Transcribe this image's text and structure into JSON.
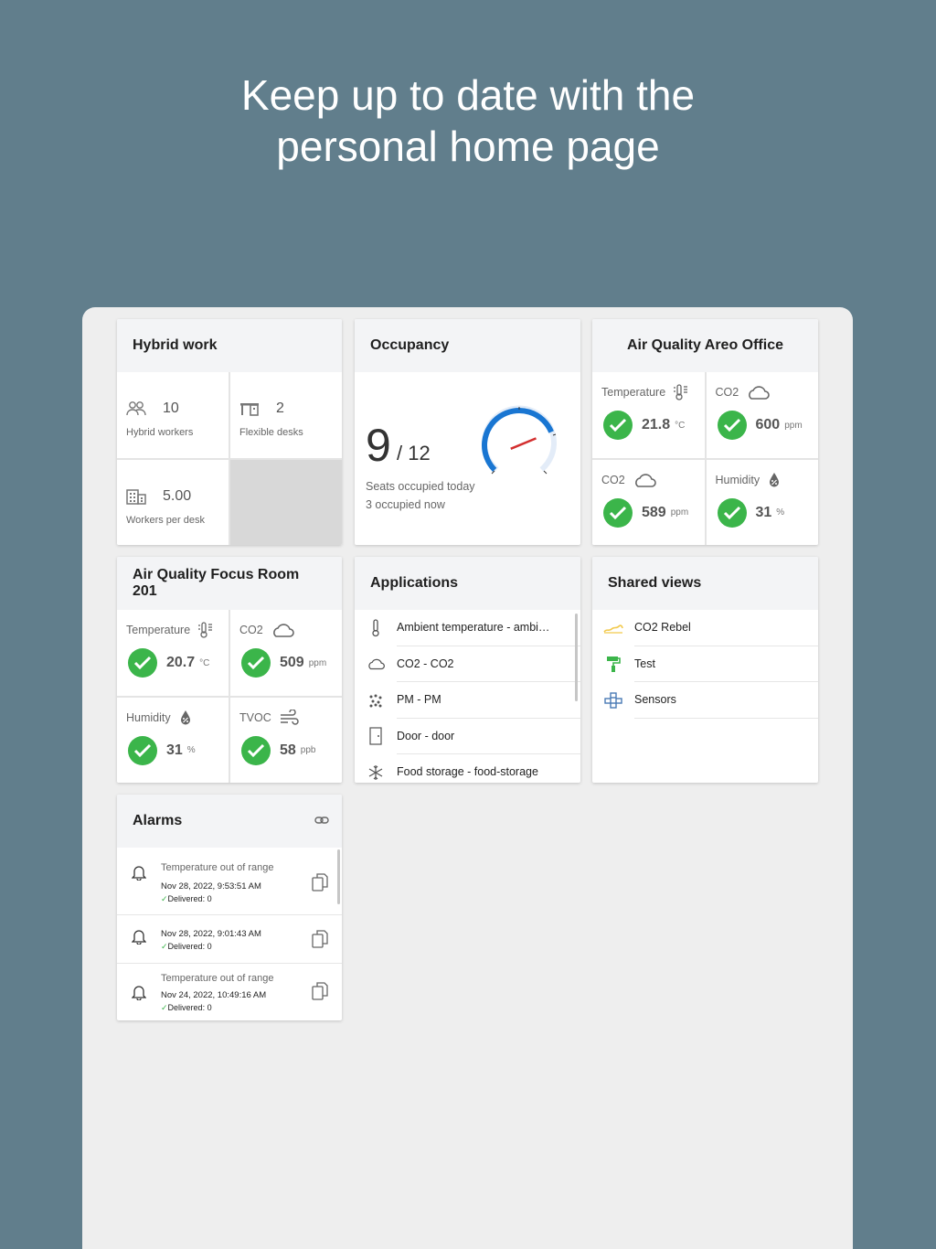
{
  "headline": {
    "line1": "Keep up to date with the",
    "line2": "personal home page"
  },
  "hybrid": {
    "title": "Hybrid work",
    "workers_value": "10",
    "workers_label": "Hybrid workers",
    "desks_value": "2",
    "desks_label": "Flexible desks",
    "ratio_value": "5.00",
    "ratio_label": "Workers per desk"
  },
  "occupancy": {
    "title": "Occupancy",
    "occupied": "9",
    "total": "/ 12",
    "line1": "Seats occupied today",
    "line2": "3 occupied now",
    "fraction": 0.75
  },
  "aq_office": {
    "title": "Air Quality Areo Office",
    "cells": [
      {
        "label": "Temperature",
        "value": "21.8",
        "unit": "°C"
      },
      {
        "label": "CO2",
        "value": "600",
        "unit": "ppm"
      },
      {
        "label": "CO2",
        "value": "589",
        "unit": "ppm"
      },
      {
        "label": "Humidity",
        "value": "31",
        "unit": "%"
      }
    ]
  },
  "aq_focus": {
    "title": "Air Quality Focus Room 201",
    "cells": [
      {
        "label": "Temperature",
        "value": "20.7",
        "unit": "°C"
      },
      {
        "label": "CO2",
        "value": "509",
        "unit": "ppm"
      },
      {
        "label": "Humidity",
        "value": "31",
        "unit": "%"
      },
      {
        "label": "TVOC",
        "value": "58",
        "unit": "ppb"
      }
    ]
  },
  "applications": {
    "title": "Applications",
    "items": [
      {
        "label": "Ambient temperature - ambi…",
        "icon": "thermometer-icon"
      },
      {
        "label": "CO2 - CO2",
        "icon": "cloud-icon"
      },
      {
        "label": "PM - PM",
        "icon": "particles-icon"
      },
      {
        "label": "Door - door",
        "icon": "door-icon"
      },
      {
        "label": "Food storage - food-storage",
        "icon": "snowflake-icon"
      }
    ]
  },
  "shared": {
    "title": "Shared views",
    "items": [
      {
        "label": "CO2 Rebel",
        "icon": "wave-icon",
        "color": "#f2c94c"
      },
      {
        "label": "Test",
        "icon": "paint-roller-icon",
        "color": "#3bb54a"
      },
      {
        "label": "Sensors",
        "icon": "network-icon",
        "color": "#4a7ab5"
      }
    ]
  },
  "alarms": {
    "title": "Alarms",
    "items": [
      {
        "title": "Temperature out of range",
        "date": "Nov 28, 2022, 9:53:51 AM",
        "delivered": "Delivered: 0"
      },
      {
        "title": "",
        "date": "Nov 28, 2022, 9:01:43 AM",
        "delivered": "Delivered: 0"
      },
      {
        "title": "Temperature out of range",
        "date": "Nov 24, 2022, 10:49:16 AM",
        "delivered": "Delivered: 0"
      }
    ]
  },
  "colors": {
    "background": "#617e8c",
    "check": "#3bb54a",
    "gauge": "#1976d2",
    "needle": "#d32f2f"
  }
}
